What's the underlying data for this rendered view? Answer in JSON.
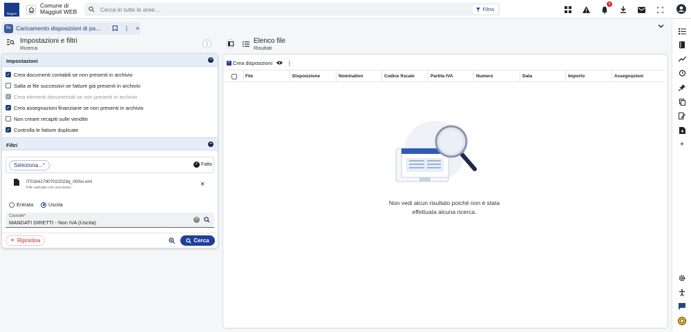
{
  "topbar": {
    "logo_text": "Maggioli",
    "app_title_line1": "Comune di",
    "app_title_line2": "Maggioli WEB",
    "search_placeholder": "Cerca in tutte le aree...",
    "filter_label": "Filtra",
    "notification_count": "4",
    "icons": [
      "grid-icon",
      "alert-icon",
      "bell-icon",
      "download-icon",
      "mail-icon",
      "fullscreen-icon",
      "account-icon"
    ]
  },
  "tab": {
    "label": "Caricamento disposizioni di pa...",
    "icon_text": "Rn"
  },
  "left": {
    "title": "Impostazioni e filtri",
    "subtitle": "Ricerca",
    "impostazioni_title": "Impostazioni",
    "settings": [
      {
        "label": "Crea documenti contabili se non presenti in archivio",
        "state": "on"
      },
      {
        "label": "Salta ai file successivi se fatture già presenti in archivio",
        "state": "off"
      },
      {
        "label": "Crea elementi documentali se non presenti in archivio",
        "state": "disabled"
      },
      {
        "label": "Crea assegnazioni finanziarie se non presenti in archivio",
        "state": "on"
      },
      {
        "label": "Non creare recapiti sulle vendite",
        "state": "off"
      },
      {
        "label": "Controlla le fatture duplicate",
        "state": "on"
      }
    ],
    "filtri_title": "Filtri",
    "select_label": "Seleziona...",
    "select_required": "*",
    "fatto_label": "Fatto",
    "file_name": "IT01641790702​2023q_000sr.xml",
    "file_status": "File caricato con successo.",
    "radio_entrata": "Entrata",
    "radio_uscita": "Uscita",
    "causale_label": "Causale",
    "causale_required": "*",
    "causale_value": "MANDATI DIRETTI - Non IVA (Uscita)",
    "reset_label": "Ripristina",
    "search_label": "Cerca"
  },
  "right": {
    "title": "Elenco file",
    "subtitle": "Risultati",
    "create_label": "Crea disposizioni",
    "columns": [
      "File",
      "Disposizione",
      "Nominativo",
      "Codice fiscale",
      "Partita IVA",
      "Numero",
      "Data",
      "Importo",
      "Assegnazioni"
    ],
    "empty_line1": "Non vedi alcun risultato poiché non è stata",
    "empty_line2": "effettuata alcuna ricerca."
  },
  "colors": {
    "primary": "#1f3f9a",
    "section_header": "#e4edf8",
    "danger": "#c62828"
  }
}
